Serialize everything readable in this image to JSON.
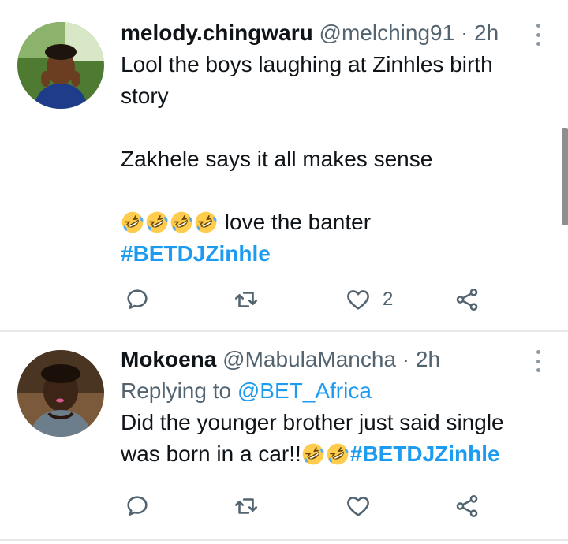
{
  "tweets": [
    {
      "name": "melody.chingwaru",
      "handle": "@melching91",
      "dot": "·",
      "time": "2h",
      "lines": [
        "Lool the boys laughing at Zinhles birth story",
        "Zakhele says it all makes sense",
        "love the banter"
      ],
      "emoji": "rolling-on-floor-laughing",
      "emoji_count": 4,
      "hashtag": "#BETDJZinhle",
      "reply_count": "",
      "retweet_count": "",
      "like_count": "2"
    },
    {
      "name": "Mokoena",
      "handle": "@MabulaMancha",
      "dot": "·",
      "time": "2h",
      "replying_to_label": "Replying to",
      "replying_to_handle": "@BET_Africa",
      "lines": [
        "Did the younger brother just said single",
        "was born in a car!!"
      ],
      "emoji": "rolling-on-floor-laughing",
      "emoji_count": 2,
      "hashtag": "#BETDJZinhle",
      "like_count": ""
    }
  ],
  "colors": {
    "link": "#1d9bf0",
    "secondary_text": "#536471",
    "primary_text": "#0f1419",
    "divider": "#e6e9eb"
  }
}
